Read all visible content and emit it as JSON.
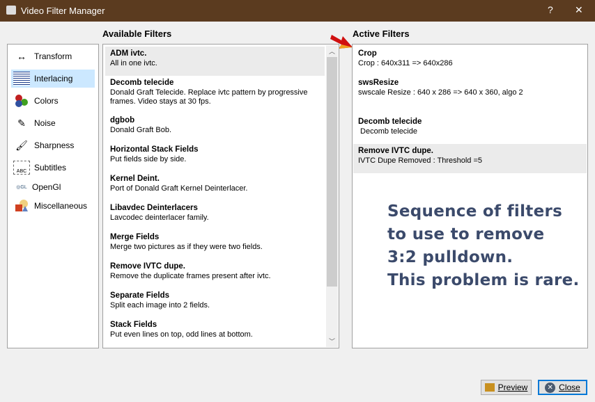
{
  "window": {
    "title": "Video Filter Manager",
    "help": "?",
    "close": "✕"
  },
  "headers": {
    "available": "Available Filters",
    "active": "Active Filters"
  },
  "categories": [
    {
      "label": "Transform",
      "icon": "transform-icon"
    },
    {
      "label": "Interlacing",
      "icon": "interlacing-icon",
      "selected": true
    },
    {
      "label": "Colors",
      "icon": "colors-icon"
    },
    {
      "label": "Noise",
      "icon": "noise-icon"
    },
    {
      "label": "Sharpness",
      "icon": "sharpness-icon"
    },
    {
      "label": "Subtitles",
      "icon": "subtitles-icon"
    },
    {
      "label": "OpenGl",
      "icon": "opengl-icon"
    },
    {
      "label": "Miscellaneous",
      "icon": "miscellaneous-icon"
    }
  ],
  "available": [
    {
      "name": "ADM ivtc.",
      "desc": "All in one ivtc."
    },
    {
      "name": "Decomb telecide",
      "desc": "Donald Graft Telecide. Replace ivtc pattern by progressive frames. Video stays at 30 fps."
    },
    {
      "name": "dgbob",
      "desc": "Donald Graft Bob."
    },
    {
      "name": "Horizontal Stack Fields",
      "desc": "Put fields side by side."
    },
    {
      "name": "Kernel Deint.",
      "desc": "Port of Donald Graft Kernel Deinterlacer."
    },
    {
      "name": "Libavdec Deinterlacers",
      "desc": "Lavcodec deinterlacer family."
    },
    {
      "name": "Merge Fields",
      "desc": "Merge two pictures as if they were two fields."
    },
    {
      "name": "Remove IVTC dupe.",
      "desc": "Remove the duplicate frames present after ivtc."
    },
    {
      "name": "Separate Fields",
      "desc": "Split each image into 2 fields."
    },
    {
      "name": "Stack Fields",
      "desc": "Put even lines on top, odd lines at bottom."
    }
  ],
  "active": [
    {
      "name": "Crop",
      "desc": "Crop : 640x311 => 640x286"
    },
    {
      "name": "swsResize",
      "desc": "swscale Resize : 640 x 286  => 640 x 360, algo 2"
    },
    {
      "name": "Decomb telecide",
      "desc": " Decomb telecide"
    },
    {
      "name": "Remove IVTC dupe.",
      "desc": "IVTC Dupe Removed : Threshold =5"
    }
  ],
  "annotation": [
    "Sequence of filters",
    "to use to remove",
    "3:2 pulldown.",
    "This problem is rare."
  ],
  "buttons": {
    "preview": "Preview",
    "close": "Close"
  }
}
